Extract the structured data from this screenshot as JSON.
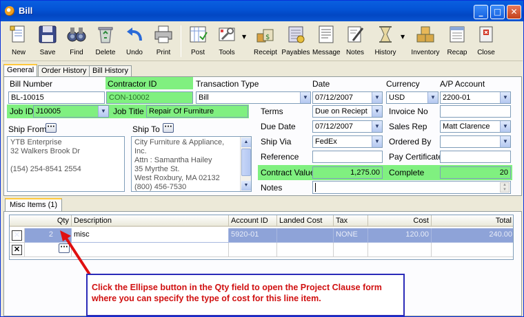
{
  "window": {
    "title": "Bill"
  },
  "toolbar": {
    "items": [
      {
        "label": "New",
        "icon": "new-document-icon"
      },
      {
        "label": "Save",
        "icon": "floppy-disk-icon"
      },
      {
        "label": "Find",
        "icon": "binoculars-icon"
      },
      {
        "label": "Delete",
        "icon": "recycle-bin-icon"
      },
      {
        "label": "Undo",
        "icon": "undo-arrow-icon"
      },
      {
        "label": "Print",
        "icon": "printer-icon"
      },
      {
        "label": "Post",
        "icon": "post-ledger-icon"
      },
      {
        "label": "Tools",
        "icon": "tools-icon"
      },
      {
        "label": "Receipt",
        "icon": "receipt-icon"
      },
      {
        "label": "Payables",
        "icon": "payables-icon"
      },
      {
        "label": "Message",
        "icon": "message-icon"
      },
      {
        "label": "Notes",
        "icon": "notes-icon"
      },
      {
        "label": "History",
        "icon": "history-icon"
      },
      {
        "label": "Inventory",
        "icon": "inventory-boxes-icon"
      },
      {
        "label": "Recap",
        "icon": "recap-icon"
      },
      {
        "label": "Close",
        "icon": "close-door-icon"
      }
    ]
  },
  "tabs": [
    "General",
    "Order History",
    "Bill History"
  ],
  "form": {
    "bill_number_label": "Bill Number",
    "bill_number": "BL-10015",
    "contractor_id_label": "Contractor ID",
    "contractor_id": "CON-10002",
    "transaction_type_label": "Transaction Type",
    "transaction_type": "Bill",
    "date_label": "Date",
    "date": "07/12/2007",
    "currency_label": "Currency",
    "currency": "USD",
    "ap_account_label": "A/P Account",
    "ap_account": "2200-01",
    "job_id_label": "Job ID",
    "job_id": "J10005",
    "job_title_label": "Job Title",
    "job_title": "Repair Of Furniture",
    "terms_label": "Terms",
    "terms": "Due on Reciept",
    "invoice_no_label": "Invoice No",
    "invoice_no": "",
    "ship_from_label": "Ship From",
    "ship_from_address": "YTB Enterprise\n32 Walkers Brook Dr\n\n(154) 254-8541 2554",
    "ship_to_label": "Ship To",
    "ship_to_address": "City Furniture & Appliance,\nInc.\nAttn : Samantha Hailey\n35 Myrthe St.\nWest Roxbury, MA 02132\n(800) 456-7530",
    "due_date_label": "Due Date",
    "due_date": "07/12/2007",
    "sales_rep_label": "Sales Rep",
    "sales_rep": "Matt Clarence",
    "ship_via_label": "Ship Via",
    "ship_via": "FedEx",
    "ordered_by_label": "Ordered By",
    "ordered_by": "",
    "reference_label": "Reference",
    "reference": "",
    "pay_certificate_label": "Pay Certificate",
    "pay_certificate": "",
    "contract_value_label": "Contract Value",
    "contract_value": "1,275.00",
    "complete_label": "Complete",
    "complete": "20",
    "notes_label": "Notes",
    "notes": ""
  },
  "misc_tab": "Misc Items (1)",
  "grid": {
    "headers": [
      "Qty",
      "Description",
      "Account ID",
      "Landed Cost",
      "Tax",
      "Cost",
      "Total"
    ],
    "rows": [
      {
        "qty": "2",
        "description": "misc",
        "account_id": "5920-01",
        "landed_cost": "",
        "tax": "NONE",
        "cost": "120.00",
        "total": "240.00"
      },
      {
        "qty": "",
        "description": "",
        "account_id": "",
        "landed_cost": "",
        "tax": "",
        "cost": "",
        "total": ""
      }
    ]
  },
  "callout": {
    "text": "Click the Ellipse button in the Qty field to open the Project Clause form where you can specify the type of cost for this line item."
  },
  "colors": {
    "title_bar": "#0454d6",
    "highlight_green": "#80f080",
    "selected_row": "#8ea3d8",
    "callout_text": "#d01010",
    "callout_border": "#2a2ab8"
  }
}
